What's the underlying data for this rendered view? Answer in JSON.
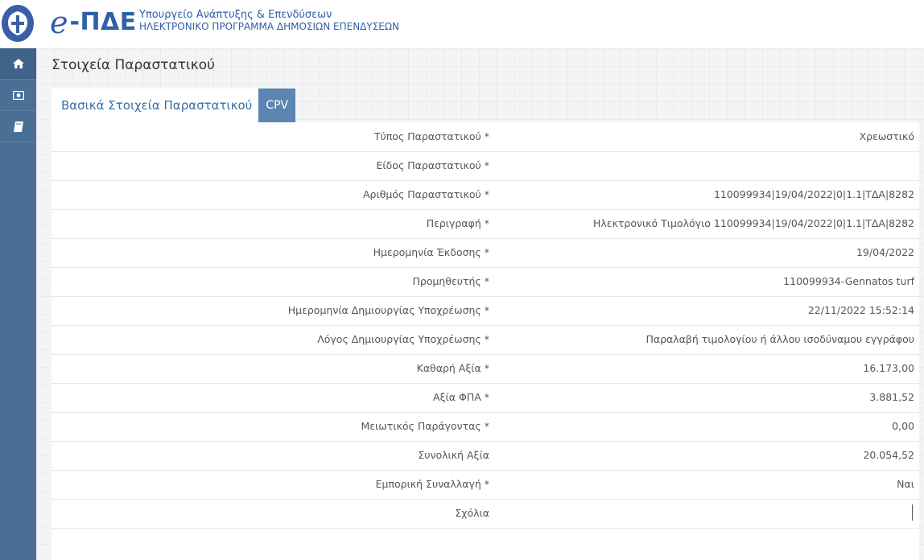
{
  "header": {
    "logo_e": "e",
    "logo_pde": "-ΠΔΕ",
    "ministry_line1": "Υπουργείο Ανάπτυξης & Επενδύσεων",
    "ministry_line2": "ΗΛΕΚΤΡΟΝΙΚΟ ΠΡΟΓΡΑΜΜΑ ΔΗΜΟΣΙΩΝ ΕΠΕΝΔΥΣΕΩΝ"
  },
  "sidebar": {
    "items": [
      {
        "icon": "home-icon"
      },
      {
        "icon": "money-icon"
      },
      {
        "icon": "book-icon"
      }
    ]
  },
  "page": {
    "title": "Στοιχεία Παραστατικού"
  },
  "tabs": [
    {
      "label": "Βασικά Στοιχεία Παραστατικού",
      "active": true
    },
    {
      "label": "CPV",
      "active": false
    }
  ],
  "form": {
    "rows": [
      {
        "label": "Τύπος Παραστατικού *",
        "value": "Χρεωστικό"
      },
      {
        "label": "Είδος Παραστατικού *",
        "value": ""
      },
      {
        "label": "Αριθμός Παραστατικού *",
        "value": "110099934|19/04/2022|0|1.1|ΤΔΑ|8282"
      },
      {
        "label": "Περιγραφή *",
        "value": "Ηλεκτρονικό Τιμολόγιο 110099934|19/04/2022|0|1.1|ΤΔΑ|8282"
      },
      {
        "label": "Ημερομηνία Έκδοσης *",
        "value": "19/04/2022"
      },
      {
        "label": "Προμηθευτής *",
        "value": "110099934-Gennatos turf"
      },
      {
        "label": "Ημερομηνία Δημιουργίας Υποχρέωσης *",
        "value": "22/11/2022 15:52:14"
      },
      {
        "label": "Λόγος Δημιουργίας Υποχρέωσης *",
        "value": "Παραλαβή τιμολογίου ή άλλου ισοδύναμου εγγράφου"
      },
      {
        "label": "Καθαρή Αξία *",
        "value": "16.173,00"
      },
      {
        "label": "Αξία ΦΠΑ *",
        "value": "3.881,52"
      },
      {
        "label": "Μειωτικός Παράγοντας *",
        "value": "0,00"
      },
      {
        "label": "Συνολική Αξία",
        "value": "20.054,52"
      },
      {
        "label": "Εμπορική Συναλλαγή *",
        "value": "Ναι"
      },
      {
        "label": "Σχόλια",
        "value": ""
      }
    ]
  }
}
